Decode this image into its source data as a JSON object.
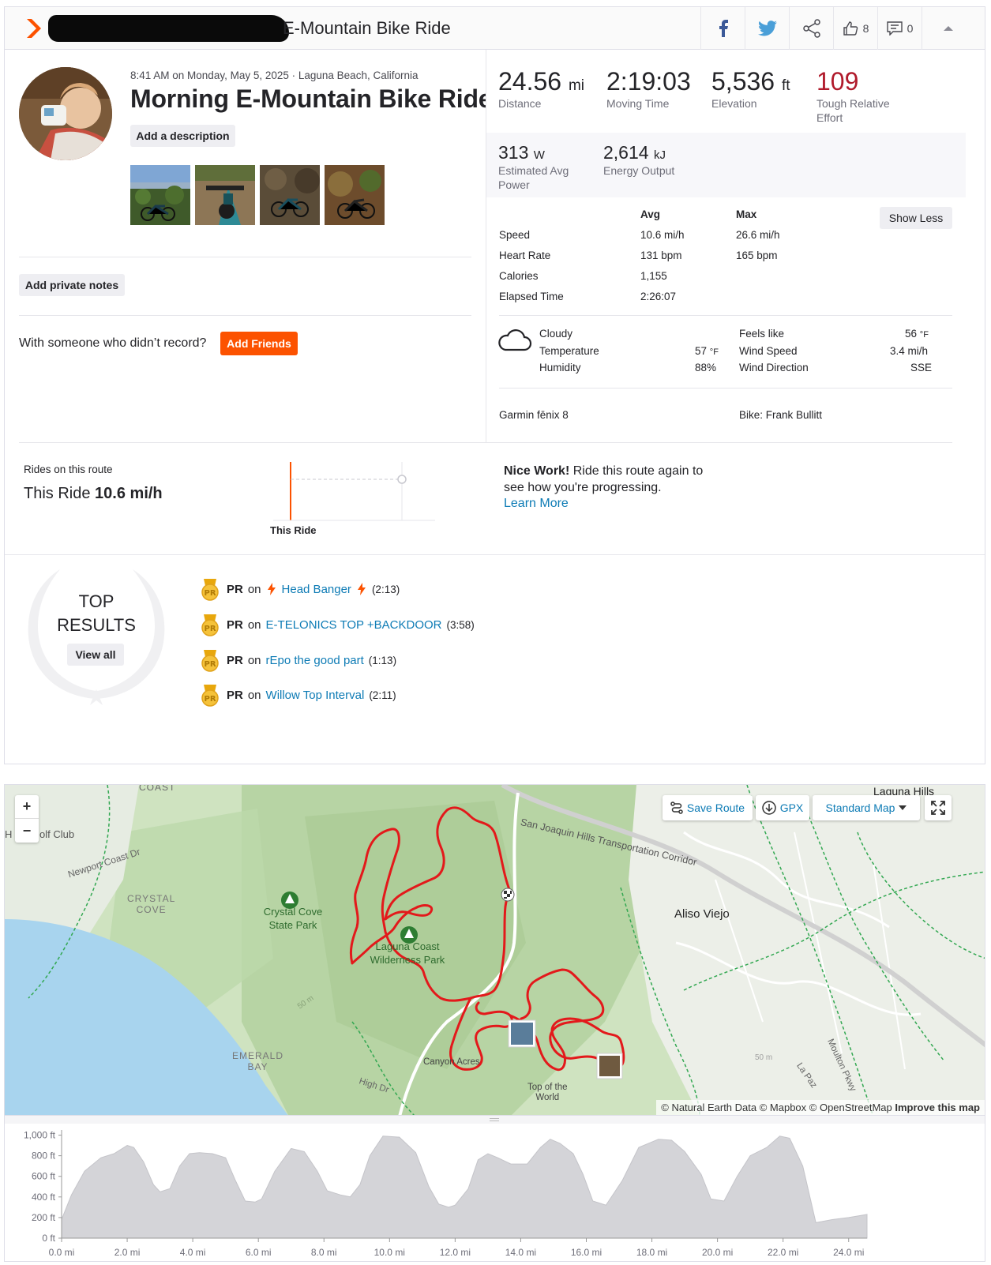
{
  "header": {
    "title_visible": "E-Mountain Bike Ride",
    "kudos_count": "8",
    "comments_count": "0"
  },
  "activity": {
    "datetime_location": "8:41 AM on Monday, May 5, 2025 · Laguna Beach, California",
    "name": "Morning E-Mountain Bike Ride",
    "add_description_label": "Add a description",
    "add_private_notes_label": "Add private notes",
    "with_someone_text": "With someone who didn’t record?",
    "add_friends_label": "Add Friends"
  },
  "stats": {
    "distance": {
      "value": "24.56",
      "unit": "mi",
      "label": "Distance"
    },
    "moving_time": {
      "value": "2:19:03",
      "label": "Moving Time"
    },
    "elevation": {
      "value": "5,536",
      "unit": "ft",
      "label": "Elevation"
    },
    "relative_effort": {
      "value": "109",
      "label": "Tough Relative Effort",
      "color": "#b01a2b"
    },
    "power": {
      "value": "313",
      "unit": "W",
      "label": "Estimated Avg Power"
    },
    "energy": {
      "value": "2,614",
      "unit": "kJ",
      "label": "Energy Output"
    }
  },
  "details": {
    "col_avg": "Avg",
    "col_max": "Max",
    "show_less_label": "Show Less",
    "rows": [
      {
        "label": "Speed",
        "avg": "10.6 mi/h",
        "max": "26.6 mi/h"
      },
      {
        "label": "Heart Rate",
        "avg": "131 bpm",
        "max": "165 bpm"
      },
      {
        "label": "Calories",
        "avg": "1,155",
        "max": ""
      },
      {
        "label": "Elapsed Time",
        "avg": "2:26:07",
        "max": ""
      }
    ]
  },
  "weather": {
    "icon": "cloud-icon",
    "condition": "Cloudy",
    "temperature_label": "Temperature",
    "temperature_value": "57",
    "temperature_unit": "°F",
    "humidity_label": "Humidity",
    "humidity_value": "88%",
    "feels_like_label": "Feels like",
    "feels_like_value": "56",
    "feels_like_unit": "°F",
    "wind_speed_label": "Wind Speed",
    "wind_speed_value": "3.4 mi/h",
    "wind_direction_label": "Wind Direction",
    "wind_direction_value": "SSE"
  },
  "gear": {
    "device": "Garmin fēnix 8",
    "bike": "Bike: Frank Bullitt"
  },
  "route_compare": {
    "heading": "Rides on this route",
    "this_ride_prefix": "This Ride",
    "this_ride_speed": "10.6 mi/h",
    "chart_label": "This Ride",
    "nice_work_bold": "Nice Work!",
    "nice_work_text": "Ride this route again to see how you're progressing.",
    "learn_more_label": "Learn More"
  },
  "top_results": {
    "line1": "TOP",
    "line2": "RESULTS",
    "view_all_label": "View all",
    "badge": "PR",
    "items": [
      {
        "prefix": "PR",
        "on": "on",
        "segment": "Head Banger",
        "time": "(2:13)",
        "kom_icons": true
      },
      {
        "prefix": "PR",
        "on": "on",
        "segment": "E-TELONICS TOP +BACKDOOR",
        "time": "(3:58)",
        "kom_icons": false
      },
      {
        "prefix": "PR",
        "on": "on",
        "segment": "rEpo the good part",
        "time": "(1:13)",
        "kom_icons": false
      },
      {
        "prefix": "PR",
        "on": "on",
        "segment": "Willow Top Interval",
        "time": "(2:11)",
        "kom_icons": false
      }
    ]
  },
  "map": {
    "zoom_in": "+",
    "zoom_out": "−",
    "save_route_label": "Save Route",
    "gpx_label": "GPX",
    "map_style_label": "Standard Map",
    "attribution": "© Natural Earth Data © Mapbox © OpenStreetMap",
    "improve_label": "Improve this map",
    "place_labels": {
      "coast": "COAST",
      "golf": "olf Club",
      "h": "H",
      "newport": "Newport Coast Dr",
      "crystal1": "CRYSTAL",
      "crystal2": "COVE",
      "ccsp1": "Crystal Cove",
      "ccsp2": "State Park",
      "lcwp1": "Laguna Coast",
      "lcwp2": "Wilderness Park",
      "sjh": "San Joaquin Hills Transportation Corridor",
      "aliso": "Aliso Viejo",
      "laguna_hills": "Laguna Hills",
      "emerald1": "EMERALD",
      "emerald2": "BAY",
      "canyon": "Canyon Acres",
      "high": "High Dr",
      "totw1": "Top of the",
      "totw2": "World",
      "moulton": "Moulton Pkwy",
      "lapaz": "La Paz",
      "fifty1": "50 m",
      "fifty2": "50 m"
    }
  },
  "chart_data": {
    "type": "area",
    "xlabel": "",
    "ylabel": "",
    "x_ticks": [
      "0.0 mi",
      "2.0 mi",
      "4.0 mi",
      "6.0 mi",
      "8.0 mi",
      "10.0 mi",
      "12.0 mi",
      "14.0 mi",
      "16.0 mi",
      "18.0 mi",
      "20.0 mi",
      "22.0 mi",
      "24.0 mi"
    ],
    "y_ticks": [
      "0 ft",
      "200 ft",
      "400 ft",
      "600 ft",
      "800 ft",
      "1,000 ft"
    ],
    "xlim": [
      0,
      24.56
    ],
    "ylim": [
      0,
      1050
    ],
    "x": [
      0,
      0.3,
      0.7,
      1.2,
      1.6,
      2.0,
      2.2,
      2.5,
      2.8,
      3.0,
      3.3,
      3.6,
      3.9,
      4.2,
      4.6,
      5.0,
      5.3,
      5.6,
      5.9,
      6.1,
      6.5,
      7.0,
      7.4,
      7.8,
      8.1,
      8.5,
      8.8,
      9.1,
      9.4,
      9.8,
      10.3,
      10.8,
      11.2,
      11.5,
      11.8,
      12.0,
      12.4,
      12.7,
      13.0,
      13.3,
      13.7,
      14.2,
      14.6,
      14.9,
      15.2,
      15.6,
      15.9,
      16.2,
      16.6,
      17.1,
      17.6,
      18.2,
      18.6,
      19.0,
      19.5,
      19.8,
      20.2,
      20.6,
      21.0,
      21.5,
      21.9,
      22.2,
      22.6,
      23.0,
      23.5,
      24.0,
      24.56
    ],
    "y": [
      180,
      420,
      650,
      780,
      820,
      900,
      880,
      740,
      520,
      450,
      480,
      700,
      820,
      830,
      820,
      780,
      560,
      360,
      350,
      380,
      650,
      870,
      840,
      650,
      460,
      420,
      400,
      520,
      800,
      990,
      980,
      830,
      500,
      330,
      300,
      320,
      480,
      760,
      820,
      780,
      720,
      720,
      880,
      960,
      920,
      820,
      620,
      360,
      320,
      560,
      880,
      960,
      950,
      840,
      620,
      380,
      360,
      600,
      800,
      880,
      990,
      970,
      700,
      150,
      180,
      200,
      230
    ],
    "fill": "#d4d4d8",
    "stroke": "#c4c4c9"
  }
}
